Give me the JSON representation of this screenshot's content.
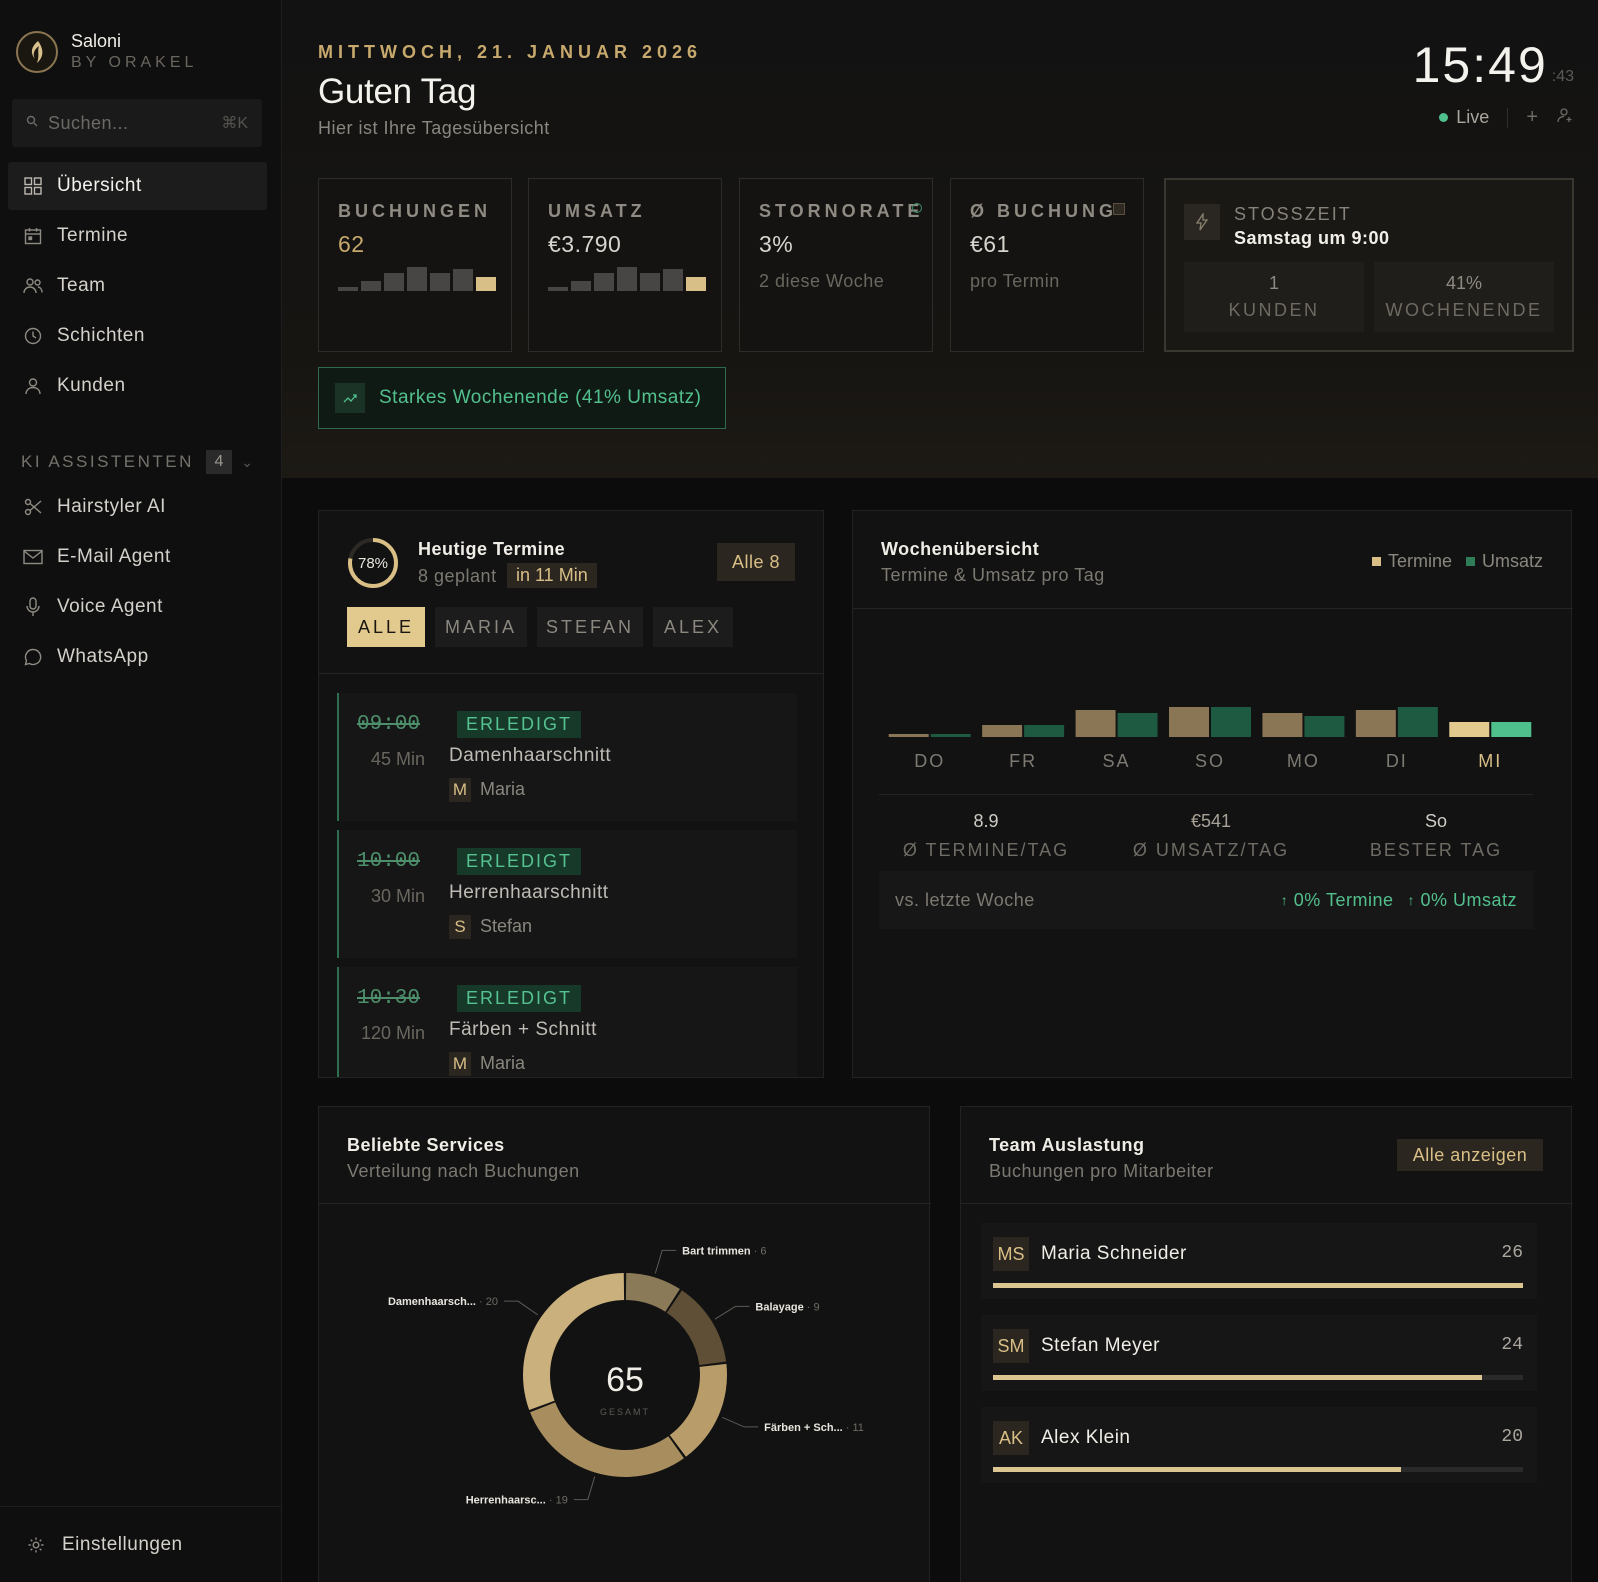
{
  "brand": {
    "name": "Saloni",
    "sub": "BY ORAKEL"
  },
  "search": {
    "placeholder": "Suchen...",
    "shortcut": "⌘K"
  },
  "nav": [
    {
      "label": "Übersicht",
      "icon": "grid-icon",
      "active": true
    },
    {
      "label": "Termine",
      "icon": "calendar-icon"
    },
    {
      "label": "Team",
      "icon": "team-icon"
    },
    {
      "label": "Schichten",
      "icon": "clock-icon"
    },
    {
      "label": "Kunden",
      "icon": "user-icon"
    }
  ],
  "ai": {
    "title": "KI ASSISTENTEN",
    "count": "4",
    "items": [
      {
        "label": "Hairstyler AI",
        "icon": "scissors-icon"
      },
      {
        "label": "E-Mail Agent",
        "icon": "mail-icon"
      },
      {
        "label": "Voice Agent",
        "icon": "mic-icon"
      },
      {
        "label": "WhatsApp",
        "icon": "chat-icon"
      }
    ]
  },
  "settings": {
    "label": "Einstellungen"
  },
  "header": {
    "date": "MITTWOCH, 21. JANUAR 2026",
    "greeting": "Guten Tag",
    "subtitle": "Hier ist Ihre Tagesübersicht",
    "time_hm": "15:49",
    "time_sec": ":43",
    "live": "Live"
  },
  "kpis": {
    "bookings": {
      "title": "BUCHUNGEN",
      "value": "62",
      "spark": [
        2,
        5,
        9,
        12,
        9,
        11,
        7
      ]
    },
    "revenue": {
      "title": "UMSATZ",
      "value": "€3.790",
      "spark": [
        2,
        5,
        9,
        12,
        9,
        11,
        7
      ]
    },
    "cancel": {
      "title": "STORNORATE",
      "value": "3%",
      "sub": "2 diese Woche"
    },
    "avg": {
      "title": "Ø BUCHUNG",
      "value": "€61",
      "sub": "pro Termin"
    }
  },
  "peak": {
    "title": "STOSSZEIT",
    "value": "Samstag um 9:00",
    "customers_value": "1",
    "customers_label": "KUNDEN",
    "weekend_value": "41%",
    "weekend_label": "WOCHENENDE"
  },
  "trend": {
    "label": "Starkes Wochenende (41% Umsatz)"
  },
  "today": {
    "title": "Heutige Termine",
    "ring": "78%",
    "ring_value": 0.78,
    "planned": "8 geplant",
    "next": "in 11 Min",
    "all_button": "Alle 8",
    "tabs": [
      "ALLE",
      "MARIA",
      "STEFAN",
      "ALEX"
    ],
    "appointments": [
      {
        "time": "09:00",
        "duration": "45 Min",
        "status": "ERLEDIGT",
        "service": "Damenhaarschnitt",
        "initial": "M",
        "staff": "Maria"
      },
      {
        "time": "10:00",
        "duration": "30 Min",
        "status": "ERLEDIGT",
        "service": "Herrenhaarschnitt",
        "initial": "S",
        "staff": "Stefan"
      },
      {
        "time": "10:30",
        "duration": "120 Min",
        "status": "ERLEDIGT",
        "service": "Färben + Schnitt",
        "initial": "M",
        "staff": "Maria"
      }
    ]
  },
  "week": {
    "title": "Wochenübersicht",
    "subtitle": "Termine & Umsatz pro Tag",
    "legend_termine": "Termine",
    "legend_umsatz": "Umsatz",
    "avg_termine": "8.9",
    "avg_termine_label": "Ø TERMINE/TAG",
    "avg_umsatz": "€541",
    "avg_umsatz_label": "Ø UMSATZ/TAG",
    "best": "So",
    "best_label": "BESTER TAG",
    "vs_label": "vs. letzte Woche",
    "vs_termine": "0% Termine",
    "vs_umsatz": "0% Umsatz"
  },
  "services": {
    "title": "Beliebte Services",
    "subtitle": "Verteilung nach Buchungen",
    "total": "65",
    "total_label": "GESAMT"
  },
  "team": {
    "title": "Team Auslastung",
    "subtitle": "Buchungen pro Mitarbeiter",
    "button": "Alle anzeigen",
    "members": [
      {
        "initials": "MS",
        "name": "Maria Schneider",
        "count": "26",
        "ratio": 1.0
      },
      {
        "initials": "SM",
        "name": "Stefan Meyer",
        "count": "24",
        "ratio": 0.923
      },
      {
        "initials": "AK",
        "name": "Alex Klein",
        "count": "20",
        "ratio": 0.769
      }
    ]
  },
  "chart_data": [
    {
      "type": "bar",
      "categories": [
        "DO",
        "FR",
        "SA",
        "SO",
        "MO",
        "DI",
        "MI"
      ],
      "series": [
        {
          "name": "Termine",
          "values": [
            1,
            4,
            9,
            10,
            8,
            9,
            5
          ]
        },
        {
          "name": "Umsatz",
          "values": [
            1,
            4,
            8,
            10,
            7,
            10,
            5
          ]
        }
      ],
      "ylim": [
        0,
        10
      ],
      "colors": {
        "Termine": "#8a7555",
        "Umsatz": "#1d5a41",
        "highlight_termine": "#e2c98e",
        "highlight_umsatz": "#4fbf8c"
      },
      "highlight": "MI"
    },
    {
      "type": "pie",
      "title": "Beliebte Services",
      "slices": [
        {
          "label": "Bart trimmen",
          "value": 6
        },
        {
          "label": "Balayage",
          "value": 9
        },
        {
          "label": "Färben + Sch...",
          "value": 11
        },
        {
          "label": "Herrenhaarsc...",
          "value": 19
        },
        {
          "label": "Damenhaarsch...",
          "value": 20
        }
      ],
      "colors": [
        "#8b7a58",
        "#5e4f36",
        "#b89d6a",
        "#a88e5e",
        "#c9b07c"
      ]
    }
  ],
  "colors": {
    "accent": "#e2c98e",
    "green": "#4fbf8c",
    "bg": "#0c0c0c"
  }
}
